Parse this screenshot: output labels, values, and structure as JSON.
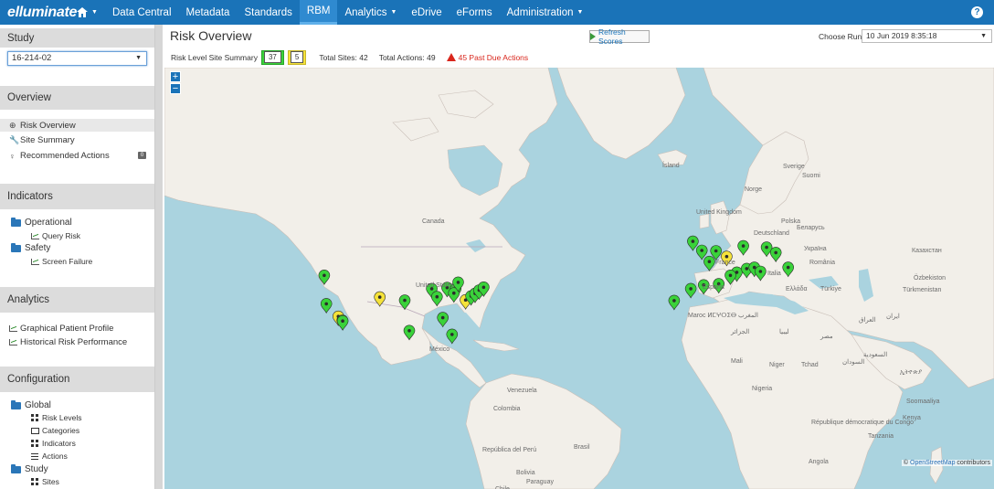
{
  "nav": {
    "logo": "elluminate",
    "items": [
      {
        "label": "Data Central",
        "caret": false
      },
      {
        "label": "Metadata",
        "caret": false
      },
      {
        "label": "Standards",
        "caret": false
      },
      {
        "label": "RBM",
        "caret": false,
        "active": true
      },
      {
        "label": "Analytics",
        "caret": true
      },
      {
        "label": "eDrive",
        "caret": false
      },
      {
        "label": "eForms",
        "caret": false
      },
      {
        "label": "Administration",
        "caret": true
      }
    ],
    "help": "?"
  },
  "sidebar": {
    "study_header": "Study",
    "study_value": "16-214-02",
    "overview_header": "Overview",
    "overview_items": [
      "Risk Overview",
      "Site Summary",
      "Recommended Actions"
    ],
    "recommended_badge": "0",
    "indicators_header": "Indicators",
    "operational": "Operational",
    "query_risk": "Query Risk",
    "safety": "Safety",
    "screen_failure": "Screen Failure",
    "analytics_header": "Analytics",
    "analytics_items": [
      "Graphical Patient Profile",
      "Historical Risk Performance"
    ],
    "configuration_header": "Configuration",
    "global": "Global",
    "global_items": [
      "Risk Levels",
      "Categories",
      "Indicators",
      "Actions"
    ],
    "study": "Study",
    "study_items": [
      "Sites"
    ]
  },
  "main": {
    "title": "Risk Overview",
    "refresh": "Refresh Scores",
    "choose_run_label": "Choose Run",
    "run_value": "10 Jun 2019 8:35:18",
    "summary_label": "Risk Level Site Summary",
    "green_count": "37",
    "yellow_count": "5",
    "total_sites": "Total Sites: 42",
    "total_actions": "Total Actions: 49",
    "past_due": "45 Past Due Actions",
    "zoom_in": "+",
    "zoom_out": "−",
    "attribution_symbol": "©",
    "attribution_link": "OpenStreetMap",
    "attribution_suffix": "contributors"
  },
  "map_labels": [
    {
      "text": "Canada",
      "kind": "country"
    },
    {
      "text": "United States",
      "kind": "country"
    },
    {
      "text": "México",
      "kind": "country"
    },
    {
      "text": "Venezuela",
      "kind": "country"
    },
    {
      "text": "Colombia",
      "kind": "country"
    },
    {
      "text": "Brasil",
      "kind": "country"
    },
    {
      "text": "República del Perú",
      "kind": "country"
    },
    {
      "text": "Bolivia",
      "kind": "country"
    },
    {
      "text": "Paraguay",
      "kind": "country"
    },
    {
      "text": "Chile",
      "kind": "country"
    },
    {
      "text": "Ísland",
      "kind": "country"
    },
    {
      "text": "Sverige",
      "kind": "country"
    },
    {
      "text": "Suomi",
      "kind": "country"
    },
    {
      "text": "Norge",
      "kind": "country"
    },
    {
      "text": "United Kingdom",
      "kind": "country"
    },
    {
      "text": "Deutschland",
      "kind": "country"
    },
    {
      "text": "Polska",
      "kind": "country"
    },
    {
      "text": "Беларусь",
      "kind": "country"
    },
    {
      "text": "Україна",
      "kind": "country"
    },
    {
      "text": "Казахстан",
      "kind": "country"
    },
    {
      "text": "France",
      "kind": "country"
    },
    {
      "text": "Italia",
      "kind": "country"
    },
    {
      "text": "România",
      "kind": "country"
    },
    {
      "text": "España",
      "kind": "country"
    },
    {
      "text": "Ελλάδα",
      "kind": "country"
    },
    {
      "text": "Türkiye",
      "kind": "country"
    },
    {
      "text": "Türkmenistan",
      "kind": "country"
    },
    {
      "text": "Özbekiston",
      "kind": "country"
    },
    {
      "text": "Maroc ⵍⵎⵖⵔⵉⴱ المغرب",
      "kind": "country"
    },
    {
      "text": "الجزائر",
      "kind": "country"
    },
    {
      "text": "ليبيا",
      "kind": "country"
    },
    {
      "text": "مصر",
      "kind": "country"
    },
    {
      "text": "العراق",
      "kind": "country"
    },
    {
      "text": "ایران",
      "kind": "country"
    },
    {
      "text": "السعودية",
      "kind": "country"
    },
    {
      "text": "Mali",
      "kind": "country"
    },
    {
      "text": "Niger",
      "kind": "country"
    },
    {
      "text": "Tchad",
      "kind": "country"
    },
    {
      "text": "السودان",
      "kind": "country"
    },
    {
      "text": "Nigeria",
      "kind": "country"
    },
    {
      "text": "ኢትዮጵያ",
      "kind": "country"
    },
    {
      "text": "Soomaaliya",
      "kind": "country"
    },
    {
      "text": "Kenya",
      "kind": "country"
    },
    {
      "text": "République démocratique du Congo",
      "kind": "country"
    },
    {
      "text": "Tanzania",
      "kind": "country"
    },
    {
      "text": "Angola",
      "kind": "country"
    }
  ],
  "markers": [
    {
      "color": "green",
      "lon": -123.0,
      "lat": 45.5
    },
    {
      "color": "green",
      "lon": -122.3,
      "lat": 37.8
    },
    {
      "color": "yellow",
      "lon": -118.4,
      "lat": 34.1
    },
    {
      "color": "green",
      "lon": -117.1,
      "lat": 32.9
    },
    {
      "color": "green",
      "lon": -117.0,
      "lat": 32.7
    },
    {
      "color": "yellow",
      "lon": -104.9,
      "lat": 39.7
    },
    {
      "color": "green",
      "lon": -96.8,
      "lat": 38.8
    },
    {
      "color": "green",
      "lon": -95.3,
      "lat": 29.7
    },
    {
      "color": "green",
      "lon": -88.0,
      "lat": 42.0
    },
    {
      "color": "green",
      "lon": -86.3,
      "lat": 39.8
    },
    {
      "color": "green",
      "lon": -84.4,
      "lat": 33.7
    },
    {
      "color": "green",
      "lon": -83.0,
      "lat": 42.3
    },
    {
      "color": "green",
      "lon": -81.4,
      "lat": 28.5
    },
    {
      "color": "green",
      "lon": -80.2,
      "lat": 42.0
    },
    {
      "color": "green",
      "lon": -80.8,
      "lat": 40.8
    },
    {
      "color": "green",
      "lon": -79.4,
      "lat": 43.7
    },
    {
      "color": "yellow",
      "lon": -77.0,
      "lat": 38.9
    },
    {
      "color": "green",
      "lon": -75.2,
      "lat": 40.0
    },
    {
      "color": "green",
      "lon": -73.9,
      "lat": 40.7
    },
    {
      "color": "green",
      "lon": -72.6,
      "lat": 41.6
    },
    {
      "color": "green",
      "lon": -71.1,
      "lat": 42.4
    },
    {
      "color": "green",
      "lon": -3.0,
      "lat": 53.5
    },
    {
      "color": "green",
      "lon": -0.1,
      "lat": 51.5
    },
    {
      "color": "green",
      "lon": 4.5,
      "lat": 51.4
    },
    {
      "color": "green",
      "lon": 13.4,
      "lat": 52.5
    },
    {
      "color": "green",
      "lon": 21.0,
      "lat": 52.2
    },
    {
      "color": "green",
      "lon": 24.0,
      "lat": 51.0
    },
    {
      "color": "green",
      "lon": 28.0,
      "lat": 47.5
    },
    {
      "color": "yellow",
      "lon": 8.0,
      "lat": 50.1
    },
    {
      "color": "green",
      "lon": 2.35,
      "lat": 48.9
    },
    {
      "color": "green",
      "lon": 11.3,
      "lat": 46.3
    },
    {
      "color": "green",
      "lon": 14.5,
      "lat": 47.2
    },
    {
      "color": "green",
      "lon": 17.0,
      "lat": 47.5
    },
    {
      "color": "green",
      "lon": 19.0,
      "lat": 46.5
    },
    {
      "color": "green",
      "lon": 9.2,
      "lat": 45.5
    },
    {
      "color": "green",
      "lon": 5.4,
      "lat": 43.3
    },
    {
      "color": "green",
      "lon": -3.7,
      "lat": 42.0
    },
    {
      "color": "green",
      "lon": -9.1,
      "lat": 38.7
    },
    {
      "color": "green",
      "lon": 0.5,
      "lat": 43.0
    }
  ],
  "colors": {
    "nav_bg": "#1a73b8",
    "marker_green": "#3ad23a",
    "marker_yellow": "#f5e23a",
    "danger": "#d9261c",
    "water": "#aad3df",
    "land": "#f2efe9"
  }
}
